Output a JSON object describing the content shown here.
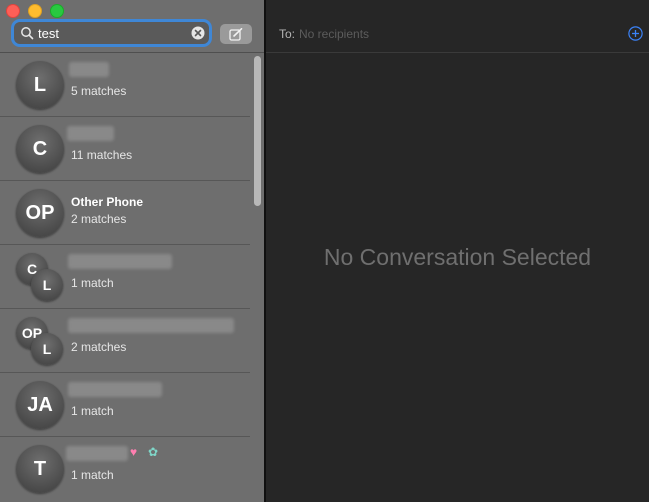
{
  "search": {
    "value": "test"
  },
  "conversations": [
    {
      "initials": "L",
      "name": "",
      "matches": "5 matches"
    },
    {
      "initials": "C",
      "name": "",
      "matches": "11 matches"
    },
    {
      "initials": "OP",
      "name": "Other Phone",
      "matches": "2 matches"
    },
    {
      "initials": "C",
      "initials2": "L",
      "name": "",
      "matches": "1 match"
    },
    {
      "initials": "OP",
      "initials2": "L",
      "name": "",
      "matches": "2 matches"
    },
    {
      "initials": "JA",
      "name": "",
      "matches": "1 match"
    },
    {
      "initials": "T",
      "name": "",
      "matches": "1 match"
    }
  ],
  "compose": {
    "icon": "compose-icon"
  },
  "recipients": {
    "label": "To:",
    "placeholder": "No recipients"
  },
  "main": {
    "empty_message": "No Conversation Selected"
  },
  "colors": {
    "focus_ring": "#3f87d6",
    "add_button": "#3b82f6"
  }
}
